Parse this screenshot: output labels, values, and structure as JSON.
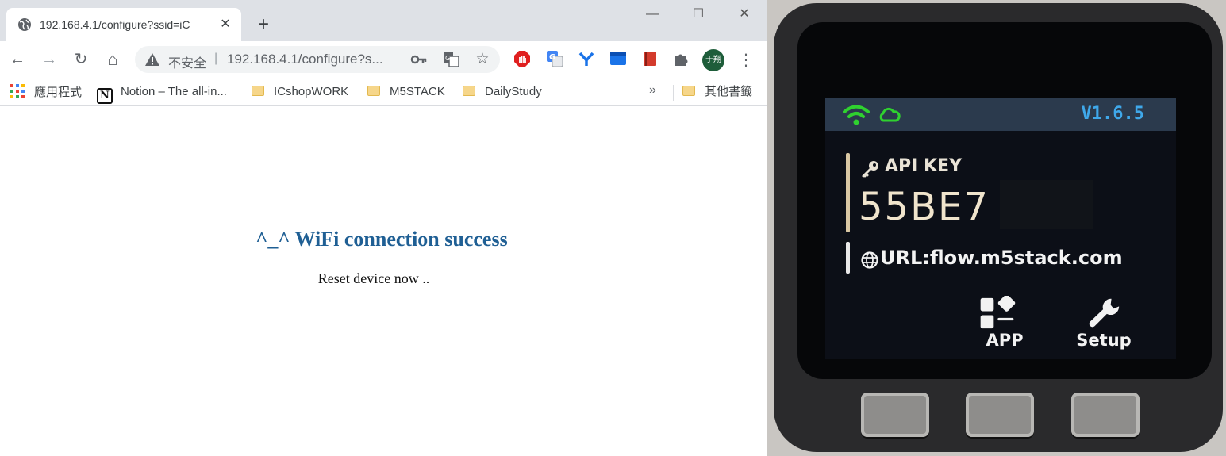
{
  "browser": {
    "tab_title": "192.168.4.1/configure?ssid=iC",
    "tab_close": "✕",
    "new_tab": "+",
    "window_controls": {
      "minimize": "—",
      "maximize": "☐",
      "close": "✕"
    },
    "nav": {
      "back": "←",
      "forward": "→",
      "reload": "↻",
      "home": "⌂"
    },
    "omnibox": {
      "security_label": "不安全",
      "separator": "|",
      "url": "192.168.4.1/configure?s...",
      "key_icon": "password-key-icon",
      "translate_icon": "translate-icon",
      "star": "☆"
    },
    "extensions": [
      "adblock-icon",
      "google-translate-icon",
      "y-extension-icon",
      "blue-extension-icon",
      "red-book-icon",
      "puzzle-icon"
    ],
    "profile_initials": "于翔",
    "menu": "⋮",
    "bookmarks": {
      "apps": "應用程式",
      "items": [
        "Notion – The all-in...",
        "ICshopWORK",
        "M5STACK",
        "DailyStudy"
      ],
      "more": "»",
      "other": "其他書籤"
    }
  },
  "page": {
    "heading": "^_^ WiFi connection success",
    "message": "Reset device now .."
  },
  "device": {
    "version": "V1.6.5",
    "api_key_label": "API KEY",
    "api_key_value": "55BE7",
    "url_text": "URL:flow.m5stack.com",
    "app_label": "APP",
    "setup_label": "Setup",
    "colors": {
      "wifi": "#2fd12f",
      "version": "#3fa8ea",
      "status_bar": "#2b3a4d",
      "key_accent": "#d9c7a3"
    }
  }
}
